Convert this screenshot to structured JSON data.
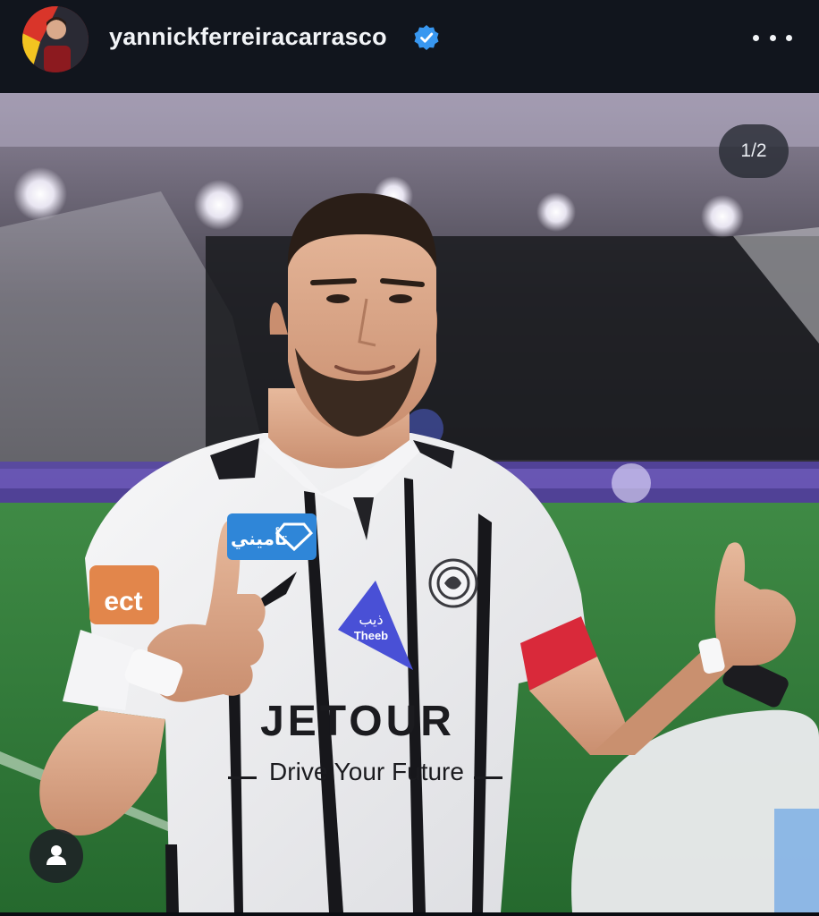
{
  "header": {
    "username": "yannickferreiracarrasco",
    "verified": true,
    "more_icon": "more-horizontal-icon"
  },
  "post": {
    "counter": "1/2",
    "tag_icon": "person-tag-icon",
    "jersey_sponsor": "JETOUR",
    "jersey_slogan": "Drive Your Future",
    "sleeve_sponsor_ar": "تأميني",
    "badge_ar": "ذيب",
    "badge_en": "Theeb",
    "sleeve_left": "ect"
  },
  "colors": {
    "header_bg": "#11151d",
    "verified_blue": "#3897f0",
    "pitch_green": "#2f7d38",
    "armband_red": "#d9293a"
  }
}
